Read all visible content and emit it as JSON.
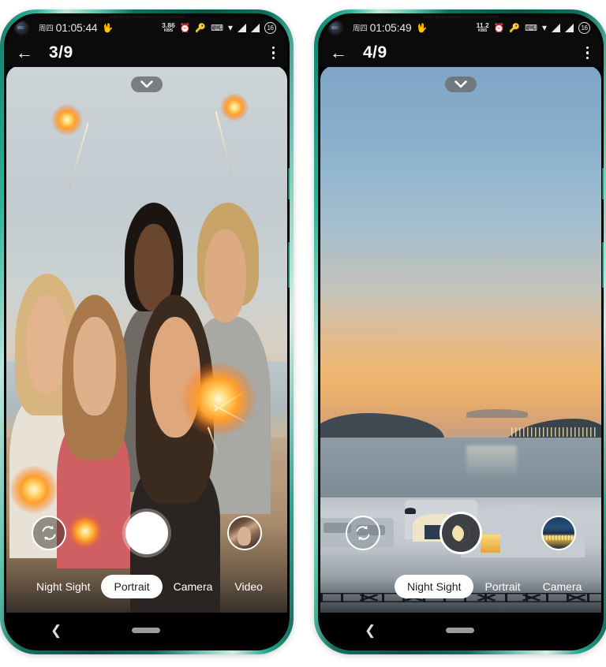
{
  "phones": [
    {
      "id": "left",
      "status_bar": {
        "punchhole_icon": "front-camera-punchhole",
        "day_of_week": "周四",
        "clock": "01:05:44",
        "app_icon": "notification-app-icon",
        "net_speed_value": "3.86",
        "net_speed_unit": "KB/S",
        "alarm_icon": "alarm-clock-icon",
        "key_icon": "vpn-key-icon",
        "keyboard_icon": "keyboard-icon",
        "wifi_icon": "wifi-icon",
        "signal1_icon": "signal-bars-icon",
        "signal2_icon": "signal-bars-icon",
        "battery_level": "16"
      },
      "title_bar": {
        "back_icon": "back-arrow-icon",
        "title": "3/9",
        "menu_icon": "overflow-menu-icon"
      },
      "viewfinder": {
        "scene": "group-selfie-with-sparklers",
        "chevron_icon": "chevron-down-icon"
      },
      "controls": {
        "switch_camera_icon": "switch-camera-icon",
        "shutter_icon": "shutter-button",
        "shutter_style": "portrait",
        "thumbnail_icon": "gallery-thumbnail-woman-with-dog"
      },
      "modes": [
        {
          "label": "Night Sight",
          "active": false
        },
        {
          "label": "Portrait",
          "active": true
        },
        {
          "label": "Camera",
          "active": false
        },
        {
          "label": "Video",
          "active": false
        }
      ],
      "nav_bar": {
        "back_icon": "nav-back-icon",
        "home_icon": "nav-home-pill"
      }
    },
    {
      "id": "right",
      "status_bar": {
        "punchhole_icon": "front-camera-punchhole",
        "day_of_week": "周四",
        "clock": "01:05:49",
        "app_icon": "notification-app-icon",
        "net_speed_value": "11.2",
        "net_speed_unit": "KB/S",
        "alarm_icon": "alarm-clock-icon",
        "key_icon": "vpn-key-icon",
        "keyboard_icon": "keyboard-icon",
        "wifi_icon": "wifi-icon",
        "signal1_icon": "signal-bars-icon",
        "signal2_icon": "signal-bars-icon",
        "battery_level": "16"
      },
      "title_bar": {
        "back_icon": "back-arrow-icon",
        "title": "4/9",
        "menu_icon": "overflow-menu-icon"
      },
      "viewfinder": {
        "scene": "sunset-seascape-white-village",
        "chevron_icon": "chevron-down-icon"
      },
      "controls": {
        "switch_camera_icon": "switch-camera-icon",
        "shutter_icon": "night-sight-moon-shutter",
        "shutter_style": "night",
        "thumbnail_icon": "gallery-thumbnail-night-cityscape"
      },
      "modes": [
        {
          "label": "Night Sight",
          "active": true
        },
        {
          "label": "Portrait",
          "active": false
        },
        {
          "label": "Camera",
          "active": false
        }
      ],
      "nav_bar": {
        "back_icon": "nav-back-icon",
        "home_icon": "nav-home-pill"
      }
    }
  ],
  "colors": {
    "frame": "#1a8a75",
    "status_bg": "#0b0b0b",
    "accent_white": "#ffffff",
    "shutter_night_fill": "#3d3f44",
    "moon": "#f3e2ae",
    "nav_home": "#9b9b9b"
  }
}
